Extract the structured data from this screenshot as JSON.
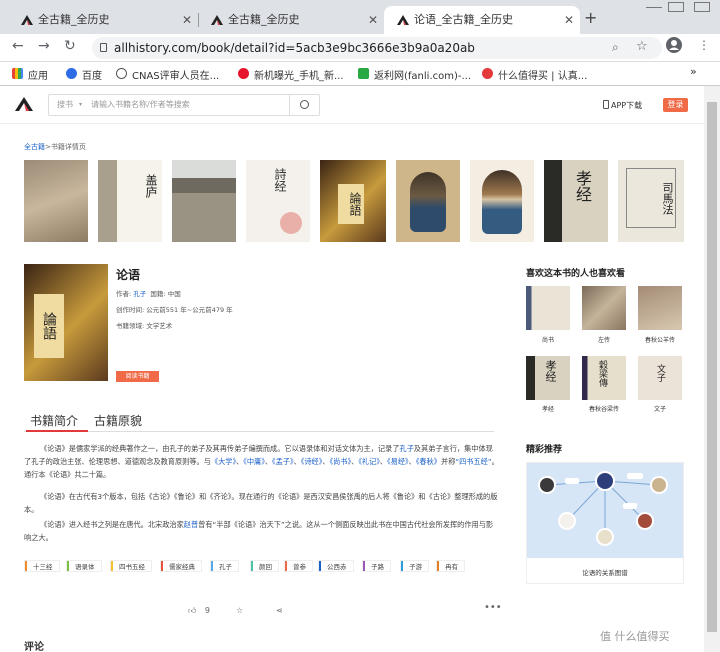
{
  "browser": {
    "tabs": [
      {
        "title": "全古籍_全历史",
        "active": false
      },
      {
        "title": "全古籍_全历史",
        "active": false
      },
      {
        "title": "论语_全古籍_全历史",
        "active": true
      }
    ],
    "new_tab": "+",
    "url": "allhistory.com/book/detail?id=5acb3e9bc3666e3b9a0a20ab",
    "bookmarks": [
      "应用",
      "百度",
      "CNAS评审人员在...",
      "新机曝光_手机_新...",
      "返利网(fanli.com)-...",
      "什么值得买 | 认真..."
    ],
    "more": "»"
  },
  "site": {
    "search_category": "搜书",
    "search_placeholder": "请输入书籍名称/作者等搜索",
    "app_download": "APP下载",
    "login": "登录"
  },
  "breadcrumb": {
    "home": "全古籍",
    "sep": ">",
    "current": "书籍详情页"
  },
  "book": {
    "title": "论语",
    "author_label": "作者:",
    "author": "孔子",
    "country_label": "国籍:",
    "country": "中国",
    "time_label": "创作时间:",
    "time": "公元前551 年~公元前479 年",
    "field_label": "书籍领域:",
    "field": "文学艺术",
    "read_button": "阅读书籍"
  },
  "content_tabs": [
    "书籍简介",
    "古籍原貌"
  ],
  "intro": {
    "p1": [
      "《论语》是儒家学派的经典著作之一，由孔子的弟子及其再传弟子编撰而成。它以语录体和对话文体为主，记录了",
      "孔子",
      "及其弟子言行，集中体现了孔子的政治主张、伦理思想、道德观念及教育原则等。与",
      "《大学》",
      "、",
      "《中庸》",
      "、",
      "《孟子》",
      "、",
      "《诗经》",
      "、",
      "《尚书》",
      "、",
      "《礼记》",
      "、",
      "《易经》",
      "、",
      "《春秋》",
      "并称",
      "“四书五经”",
      "。通行本《论语》共二十篇。"
    ],
    "p2": "《论语》在古代有3个版本，包括《古论》《鲁论》和《齐论》。现在通行的《论语》是西汉安昌侯张禹的后人将《鲁论》和《古论》整理形成的版本。",
    "p3a": "《论语》进入经书之列是在唐代。北宋政治家",
    "p3b": "赵普",
    "p3c": "曾有“半部《论语》治天下”之说。这从一个侧面反映出此书在中国古代社会所发挥的作用与影响之大。"
  },
  "tags": [
    "十三经",
    "语录体",
    "四书五经",
    "儒家经典",
    "孔子",
    "颜回",
    "曾参",
    "公西赤",
    "子路",
    "子游",
    "冉有"
  ],
  "tag_colors": [
    "#f28a2a",
    "#7bc043",
    "#f2c12e",
    "#e8543a",
    "#5aa9e6",
    "#4cc3a6",
    "#f06a47",
    "#1a5fc7",
    "#9b59b6",
    "#2d9cdb",
    "#e67e22"
  ],
  "actions": {
    "like_count": "9"
  },
  "comments_title": "评论",
  "sidebar": {
    "also_like_title": "喜欢这本书的人也喜欢看",
    "books": [
      "尚书",
      "左传",
      "春秋公羊传",
      "孝经",
      "春秋谷梁传",
      "文子"
    ],
    "recommend_title": "精彩推荐",
    "recommend_caption": "论语的关系图谱"
  },
  "watermark": "值 什么值得买",
  "colors": {
    "accent": "#f06a47",
    "link": "#1a5fc7",
    "tab_underline": "#e4393c"
  }
}
